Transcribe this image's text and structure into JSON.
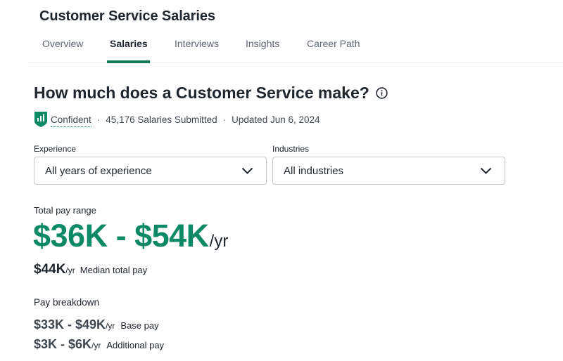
{
  "page_title": "Customer Service Salaries",
  "tabs": [
    {
      "label": "Overview",
      "active": false
    },
    {
      "label": "Salaries",
      "active": true
    },
    {
      "label": "Interviews",
      "active": false
    },
    {
      "label": "Insights",
      "active": false
    },
    {
      "label": "Career Path",
      "active": false
    }
  ],
  "headline": "How much does a Customer Service make?",
  "meta": {
    "confidence": "Confident",
    "salaries_submitted": "45,176 Salaries Submitted",
    "updated": "Updated Jun 6, 2024",
    "separator": "·"
  },
  "filters": {
    "experience": {
      "label": "Experience",
      "value": "All years of experience"
    },
    "industries": {
      "label": "Industries",
      "value": "All industries"
    }
  },
  "total_pay": {
    "label": "Total pay range",
    "range": "$36K - $54K",
    "unit": "/yr"
  },
  "median": {
    "value": "$44K",
    "unit": "/yr",
    "label": "Median total pay"
  },
  "breakdown": {
    "label": "Pay breakdown",
    "base": {
      "value": "$33K - $49K",
      "unit": "/yr",
      "label": "Base pay"
    },
    "additional": {
      "value": "$3K - $6K",
      "unit": "/yr",
      "label": "Additional pay"
    }
  },
  "icons": {
    "info": "info-icon",
    "confidence": "shield-bar-chart-icon",
    "chevron": "chevron-down-icon"
  },
  "colors": {
    "accent_green": "#0d8a65",
    "tab_underline": "#0d7b5c",
    "text": "#20262e"
  }
}
